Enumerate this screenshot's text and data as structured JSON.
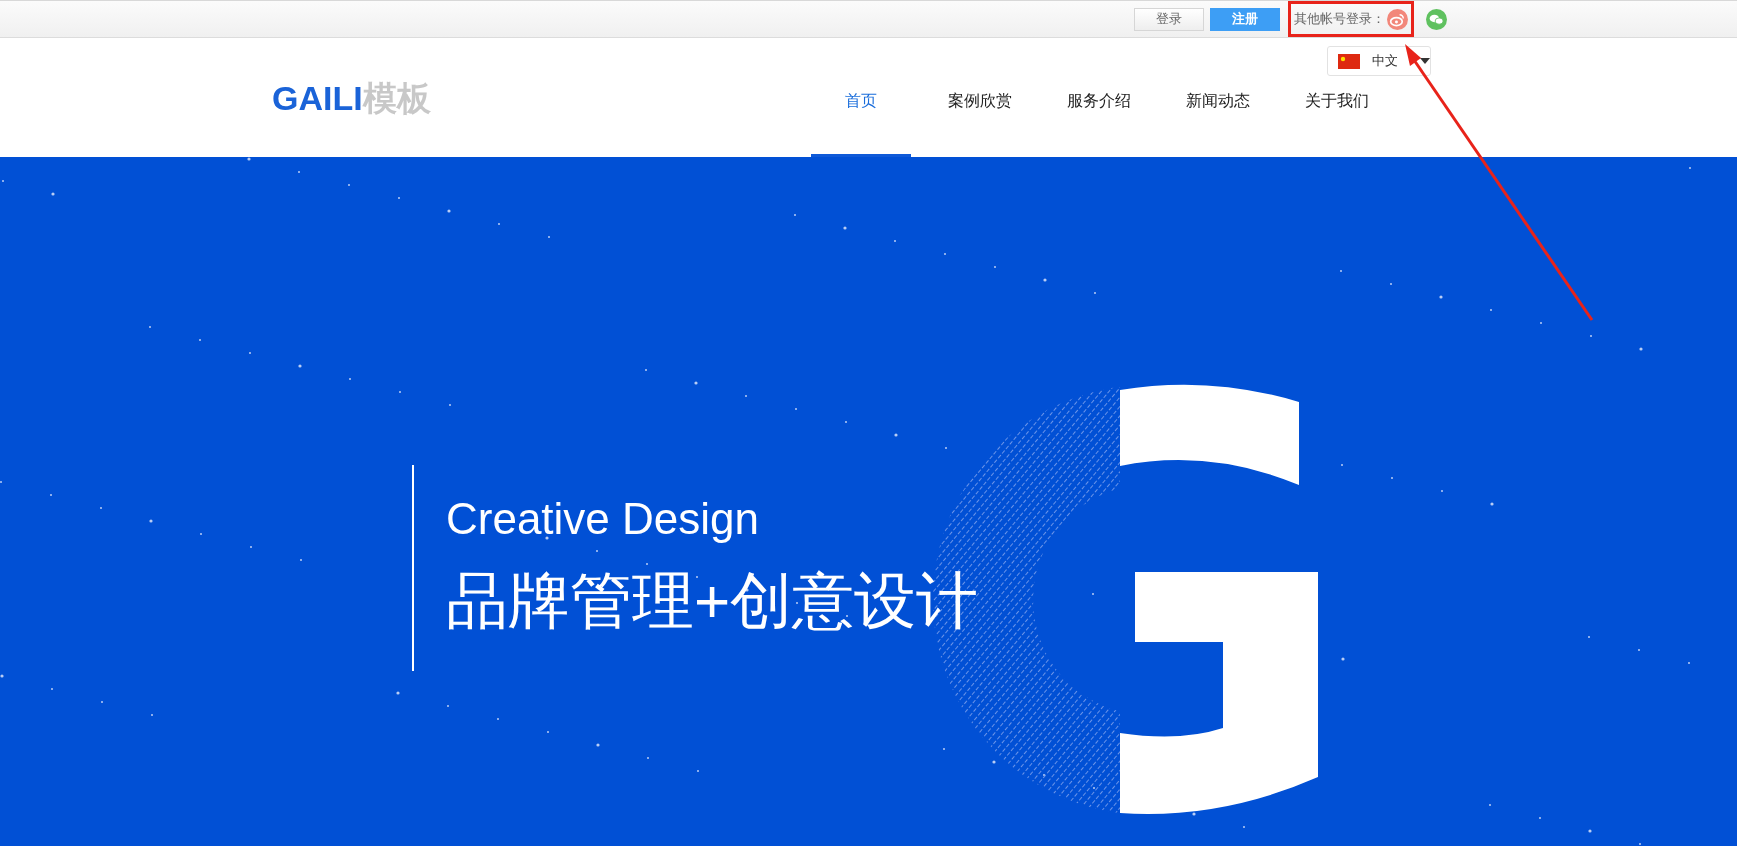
{
  "top_bar": {
    "buttons": [
      {
        "label": "登录",
        "kind": "plain"
      },
      {
        "label": "注册",
        "kind": "primary"
      }
    ],
    "other_login": {
      "label": "其他帐号登录："
    }
  },
  "language": {
    "label": "中文"
  },
  "logo": {
    "primary": "GAILI",
    "secondary": "模板"
  },
  "nav": [
    {
      "label": "首页",
      "selected": true
    },
    {
      "label": "案例欣赏",
      "selected": false
    },
    {
      "label": "服务介绍",
      "selected": false
    },
    {
      "label": "新闻动态",
      "selected": false
    },
    {
      "label": "关于我们",
      "selected": false
    }
  ],
  "hero": {
    "title": "Creative Design",
    "subtitle": "品牌管理+创意设计"
  }
}
